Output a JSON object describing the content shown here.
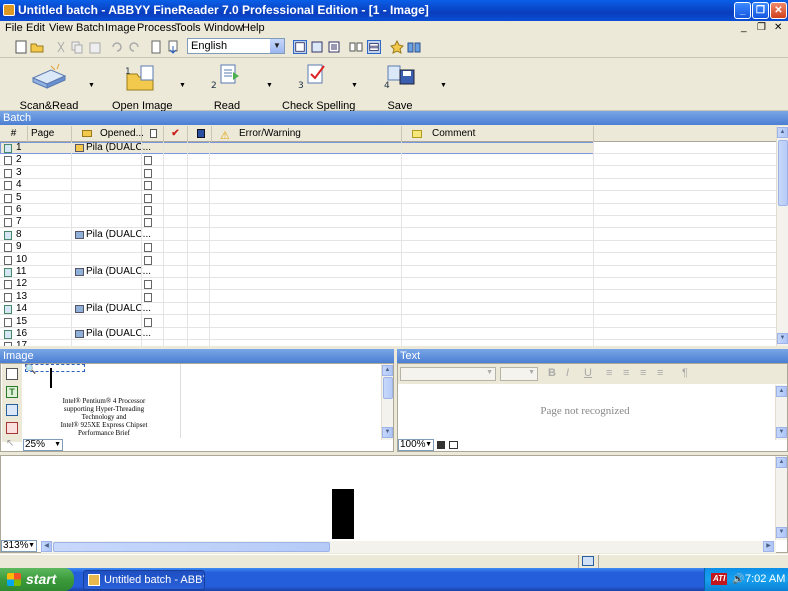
{
  "window": {
    "title": "Untitled batch - ABBYY FineReader 7.0 Professional Edition - [1 - Image]"
  },
  "menu": [
    "File",
    "Edit",
    "View",
    "Batch",
    "Image",
    "Process",
    "Tools",
    "Window",
    "Help"
  ],
  "std_toolbar": {
    "language": "English"
  },
  "main_toolbar": {
    "buttons": [
      {
        "label": "Scan&Read",
        "step": ""
      },
      {
        "label": "Open Image",
        "step": "1"
      },
      {
        "label": "Read",
        "step": "2"
      },
      {
        "label": "Check Spelling",
        "step": "3"
      },
      {
        "label": "Save",
        "step": "4"
      }
    ]
  },
  "batch": {
    "title": "Batch",
    "columns": {
      "num": "#",
      "page": "Page n...",
      "opened": "Opened...",
      "error": "Error/Warning",
      "comment": "Comment"
    },
    "rows": [
      {
        "num": "1",
        "opened": "Pila (DUALC...",
        "image": true,
        "doc": false
      },
      {
        "num": "2",
        "opened": "",
        "image": false,
        "doc": true
      },
      {
        "num": "3",
        "opened": "",
        "image": false,
        "doc": true
      },
      {
        "num": "4",
        "opened": "",
        "image": false,
        "doc": true
      },
      {
        "num": "5",
        "opened": "",
        "image": false,
        "doc": true
      },
      {
        "num": "6",
        "opened": "",
        "image": false,
        "doc": true
      },
      {
        "num": "7",
        "opened": "",
        "image": false,
        "doc": true
      },
      {
        "num": "8",
        "opened": "Pila (DUALC...",
        "image": true,
        "doc": false
      },
      {
        "num": "9",
        "opened": "",
        "image": false,
        "doc": true
      },
      {
        "num": "10",
        "opened": "",
        "image": false,
        "doc": true
      },
      {
        "num": "11",
        "opened": "Pila (DUALC...",
        "image": true,
        "doc": false
      },
      {
        "num": "12",
        "opened": "",
        "image": false,
        "doc": true
      },
      {
        "num": "13",
        "opened": "",
        "image": false,
        "doc": true
      },
      {
        "num": "14",
        "opened": "Pila (DUALC...",
        "image": true,
        "doc": false
      },
      {
        "num": "15",
        "opened": "",
        "image": false,
        "doc": true
      },
      {
        "num": "16",
        "opened": "Pila (DUALC...",
        "image": true,
        "doc": false
      },
      {
        "num": "17",
        "opened": "",
        "image": false,
        "doc": false
      }
    ]
  },
  "image_panel": {
    "title": "Image",
    "zoom": "25%",
    "thumb_lines": [
      "Intel® Pentium® 4 Processor",
      "supporting Hyper-Threading",
      "Technology and",
      "Intel® 925XE Express Chipset",
      "Performance Brief"
    ]
  },
  "text_panel": {
    "title": "Text",
    "zoom": "100%",
    "message": "Page not recognized"
  },
  "zoom_panel": {
    "zoom": "313%"
  },
  "taskbar": {
    "start": "start",
    "task": "Untitled batch - ABBY...",
    "time": "7:02 AM",
    "tray_label": "ATI"
  },
  "colors": {
    "title": "#0a3dbd",
    "panel_header": "#5a8ad8",
    "start": "#3c9a3c"
  }
}
